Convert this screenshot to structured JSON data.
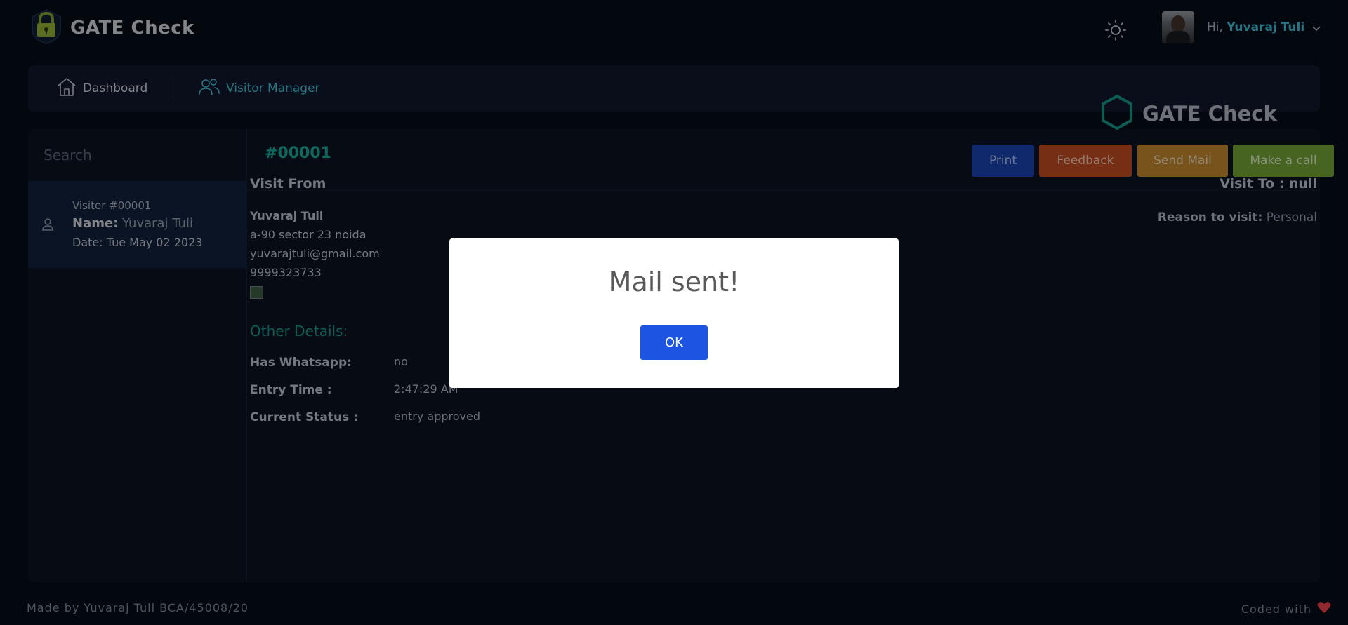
{
  "app": {
    "title": "GATE Check"
  },
  "header": {
    "greeting": "Hi,",
    "user_name": "Yuvaraj Tuli"
  },
  "nav": {
    "items": [
      {
        "label": "Dashboard",
        "icon": "home-icon"
      },
      {
        "label": "Visitor Manager",
        "icon": "users-icon",
        "active": true
      }
    ]
  },
  "sidebar": {
    "search_placeholder": "Search",
    "visitors": [
      {
        "id": "Visiter #00001",
        "name_label": "Name:",
        "name": "Yuvaraj Tuli",
        "date": "Date: Tue May 02 2023"
      }
    ]
  },
  "detail": {
    "code": "#00001",
    "buttons": {
      "print": "Print",
      "feedback": "Feedback",
      "send_mail": "Send Mail",
      "call": "Make a call"
    },
    "brand": "GATE Check",
    "visit_from_title": "Visit From",
    "from": {
      "name": "Yuvaraj Tuli",
      "address": "a-90 sector 23 noida",
      "email": "yuvarajtuli@gmail.com",
      "phone": "9999323733"
    },
    "visit_to": "Visit To : null",
    "reason_label": "Reason to visit:",
    "reason_value": "Personal",
    "other_title": "Other Details:",
    "other": [
      {
        "label": "Has Whatsapp:",
        "value": "no"
      },
      {
        "label": "Entry Time :",
        "value": "2:47:29 AM"
      },
      {
        "label": "Current Status :",
        "value": "entry approved"
      }
    ]
  },
  "footer": {
    "left": "Made by Yuvaraj Tuli BCA/45008/20",
    "right": "Coded with"
  },
  "modal": {
    "title": "Mail sent!",
    "ok_label": "OK"
  },
  "colors": {
    "accent": "#3fb3c9",
    "teal": "#18a08f",
    "print": "#1a3ea6",
    "feedback": "#b6471f",
    "send_mail": "#b8812b",
    "call": "#6d9a34",
    "ok": "#1d55e2",
    "heart": "#e0404a"
  }
}
